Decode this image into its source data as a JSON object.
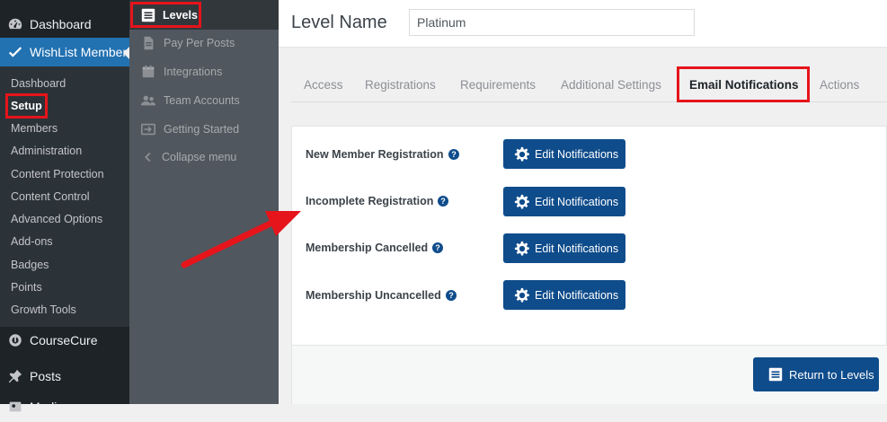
{
  "wp_sidebar": {
    "dashboard": "Dashboard",
    "wishlist_member": "WishList Member",
    "submenu": [
      "Dashboard",
      "Setup",
      "Members",
      "Administration",
      "Content Protection",
      "Content Control",
      "Advanced Options",
      "Add-ons",
      "Badges",
      "Points",
      "Growth Tools"
    ],
    "current_submenu": "Setup",
    "coursecure": "CourseCure",
    "posts": "Posts",
    "media": "Media"
  },
  "wlm_menu": {
    "levels": "Levels",
    "pay_per_posts": "Pay Per Posts",
    "integrations": "Integrations",
    "team_accounts": "Team Accounts",
    "getting_started": "Getting Started",
    "collapse_menu": "Collapse menu"
  },
  "header": {
    "level_name_label": "Level Name",
    "level_name_value": "Platinum"
  },
  "tabs": [
    {
      "label": "Access"
    },
    {
      "label": "Registrations"
    },
    {
      "label": "Requirements"
    },
    {
      "label": "Additional Settings"
    },
    {
      "label": "Email Notifications",
      "active": true
    },
    {
      "label": "Actions"
    }
  ],
  "notifications": [
    {
      "label": "New Member Registration",
      "button": "Edit Notifications"
    },
    {
      "label": "Incomplete Registration",
      "button": "Edit Notifications"
    },
    {
      "label": "Membership Cancelled",
      "button": "Edit Notifications"
    },
    {
      "label": "Membership Uncancelled",
      "button": "Edit Notifications"
    }
  ],
  "footer": {
    "return_button": "Return to Levels"
  },
  "icons": {
    "dashboard": "dashboard-icon",
    "wishlist": "checkmark-icon",
    "coursecure": "coursecure-icon",
    "posts": "pin-icon",
    "media": "media-icon",
    "levels": "list-icon",
    "pay_per_posts": "document-icon",
    "integrations": "calendar-icon",
    "team_accounts": "users-icon",
    "getting_started": "sign-in-icon",
    "collapse": "chevron-left-icon",
    "help": "question-circle-icon",
    "gear": "gear-icon"
  },
  "colors": {
    "wp_sidebar_bg": "#1d2327",
    "wp_active": "#2271b1",
    "plugin_menu_bg": "#50575e",
    "primary_button": "#0f4c8b",
    "highlight": "#e6141b"
  }
}
